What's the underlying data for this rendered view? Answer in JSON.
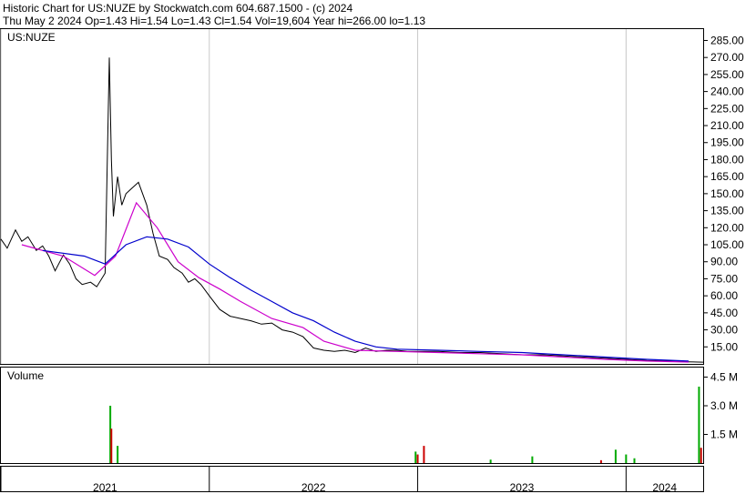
{
  "header": {
    "line1": "Historic Chart for US:NUZE by Stockwatch.com 604.687.1500 - (c) 2024",
    "line2": "Thu May  2 2024  Op=1.43  Hi=1.54  Lo=1.43  Cl=1.54  Vol=19,604  Year hi=266.00  lo=1.13"
  },
  "colors": {
    "price": "#000000",
    "ma_short": "#cc00cc",
    "ma_long": "#0000cc",
    "vol_up": "#00aa00",
    "vol_down": "#cc0000",
    "grid": "#c8c8c8",
    "recent_price": "#cc0000"
  },
  "chart_data": [
    {
      "type": "line",
      "symbol_label": "US:NUZE",
      "y_axis_side": "right",
      "ylim": [
        0,
        295
      ],
      "y_ticks": [
        "285.00",
        "270.00",
        "255.00",
        "240.00",
        "225.00",
        "210.00",
        "195.00",
        "180.00",
        "165.00",
        "150.00",
        "135.00",
        "120.00",
        "105.00",
        "90.00",
        "75.00",
        "60.00",
        "45.00",
        "30.00",
        "15.00"
      ],
      "y_tick_values": [
        285,
        270,
        255,
        240,
        225,
        210,
        195,
        180,
        165,
        150,
        135,
        120,
        105,
        90,
        75,
        60,
        45,
        30,
        15
      ],
      "x_range": [
        2021.0,
        2024.37
      ],
      "series": [
        {
          "values_x": [
            2021.0,
            2021.03,
            2021.07,
            2021.1,
            2021.13,
            2021.17,
            2021.2,
            2021.23,
            2021.26,
            2021.3,
            2021.33,
            2021.36,
            2021.39,
            2021.43,
            2021.46,
            2021.5,
            2021.52,
            2021.53,
            2021.54,
            2021.56,
            2021.58,
            2021.6,
            2021.63,
            2021.66,
            2021.7,
            2021.73,
            2021.76,
            2021.8,
            2021.83,
            2021.87,
            2021.9,
            2021.93,
            2021.96,
            2022.0,
            2022.05,
            2022.1,
            2022.15,
            2022.2,
            2022.25,
            2022.3,
            2022.35,
            2022.4,
            2022.45,
            2022.5,
            2022.55,
            2022.6,
            2022.65,
            2022.7,
            2022.75,
            2022.8,
            2022.85,
            2022.9,
            2022.95,
            2023.0,
            2023.1,
            2023.2,
            2023.3,
            2023.4,
            2023.5,
            2023.6,
            2023.7,
            2023.8,
            2023.9,
            2024.0,
            2024.1,
            2024.2,
            2024.3,
            2024.37
          ],
          "values": [
            110,
            102,
            118,
            108,
            112,
            100,
            104,
            95,
            82,
            96,
            88,
            75,
            70,
            72,
            68,
            80,
            270,
            180,
            130,
            165,
            140,
            150,
            155,
            160,
            140,
            115,
            95,
            92,
            85,
            80,
            72,
            75,
            70,
            60,
            48,
            42,
            40,
            38,
            35,
            36,
            30,
            28,
            24,
            14,
            12,
            11,
            12,
            10,
            14,
            11,
            12,
            12,
            11,
            11,
            11,
            10,
            10,
            9,
            8,
            8,
            7,
            6,
            5,
            4,
            3,
            2.5,
            1.8,
            1.5
          ]
        },
        {
          "values_x": [
            2021.1,
            2021.3,
            2021.45,
            2021.55,
            2021.65,
            2021.75,
            2021.85,
            2021.95,
            2022.05,
            2022.15,
            2022.3,
            2022.45,
            2022.55,
            2022.7,
            2022.9,
            2023.1,
            2023.3,
            2023.5,
            2023.7,
            2023.9,
            2024.1,
            2024.3
          ],
          "values": [
            105,
            95,
            78,
            95,
            142,
            120,
            90,
            76,
            66,
            55,
            40,
            32,
            20,
            12,
            11,
            10,
            9,
            8,
            6,
            4,
            2.5,
            1.6
          ]
        },
        {
          "values_x": [
            2021.2,
            2021.4,
            2021.5,
            2021.6,
            2021.7,
            2021.8,
            2021.9,
            2022.0,
            2022.1,
            2022.2,
            2022.3,
            2022.4,
            2022.5,
            2022.6,
            2022.7,
            2022.8,
            2022.9,
            2023.1,
            2023.3,
            2023.5,
            2023.7,
            2023.9,
            2024.1,
            2024.3
          ],
          "values": [
            100,
            95,
            88,
            105,
            112,
            110,
            103,
            88,
            76,
            65,
            55,
            45,
            38,
            28,
            20,
            15,
            13,
            12,
            11,
            10,
            8,
            6,
            4,
            2.5
          ]
        }
      ]
    },
    {
      "type": "bar",
      "panel_label": "Volume",
      "ylim": [
        0,
        5000000
      ],
      "y_ticks": [
        "4.5 M",
        "3.0 M",
        "1.5 M"
      ],
      "y_tick_values": [
        4500000,
        3000000,
        1500000
      ],
      "x_ticks": [
        "2021",
        "2022",
        "2023",
        "2024"
      ],
      "x_tick_values": [
        2021.0,
        2022.0,
        2023.0,
        2024.0
      ],
      "x": [
        2021.525,
        2021.53,
        2021.56,
        2022.99,
        2023.0,
        2023.03,
        2023.35,
        2023.55,
        2023.88,
        2023.95,
        2024.0,
        2024.04,
        2024.35,
        2024.36
      ],
      "values": [
        3000000,
        1800000,
        900000,
        600000,
        450000,
        900000,
        180000,
        350000,
        150000,
        700000,
        450000,
        250000,
        4000000,
        800000
      ],
      "colors": [
        "green",
        "red",
        "green",
        "green",
        "red",
        "red",
        "green",
        "green",
        "red",
        "green",
        "green",
        "green",
        "green",
        "red"
      ]
    }
  ]
}
